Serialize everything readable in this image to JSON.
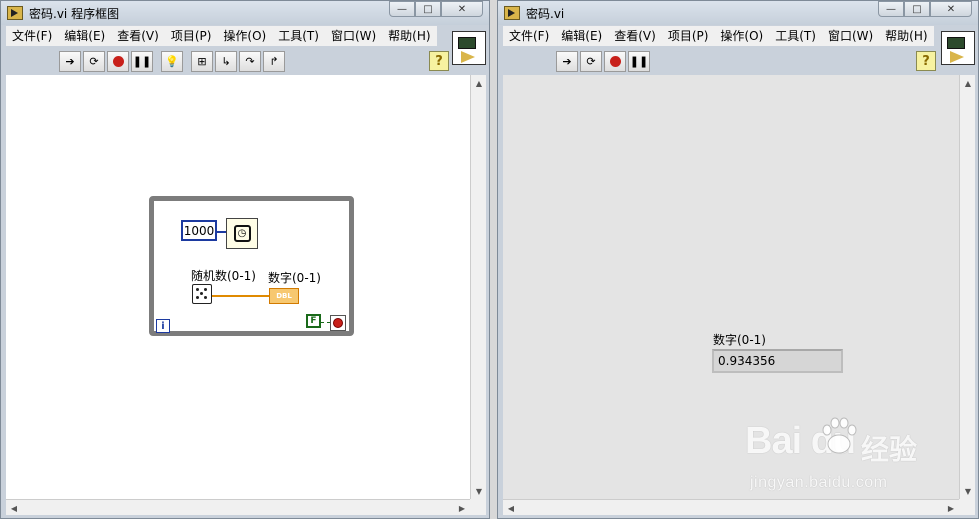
{
  "left_window": {
    "title": "密码.vi 程序框图",
    "menu": [
      "文件(F)",
      "编辑(E)",
      "查看(V)",
      "项目(P)",
      "操作(O)",
      "工具(T)",
      "窗口(W)",
      "帮助(H)"
    ],
    "toolbar": [
      "run-arrow",
      "run-continuous",
      "abort",
      "pause",
      "highlight-execution",
      "retain-wire-values",
      "step-into",
      "step-over",
      "step-out"
    ],
    "diagram": {
      "wait_constant": "1000",
      "random_label": "随机数(0-1)",
      "indicator_label": "数字(0-1)",
      "indicator_type": "DBL",
      "iteration_terminal": "i",
      "stop_constant": "F"
    }
  },
  "right_window": {
    "title": "密码.vi",
    "menu": [
      "文件(F)",
      "编辑(E)",
      "查看(V)",
      "项目(P)",
      "操作(O)",
      "工具(T)",
      "窗口(W)",
      "帮助(H)"
    ],
    "toolbar": [
      "run-arrow",
      "run-continuous",
      "abort",
      "pause"
    ],
    "front_panel": {
      "indicator_label": "数字(0-1)",
      "indicator_value": "0.934356"
    }
  },
  "help_button_label": "?",
  "watermark": {
    "main": "Bai du",
    "cn": "经验",
    "url": "jingyan.baidu.com"
  },
  "colors": {
    "integer_wire": "#1c3aa0",
    "double_wire": "#e08a00",
    "boolean_wire": "#1a6a1a",
    "while_loop_border": "#7c7c7c",
    "stop_button": "#c8201a"
  }
}
